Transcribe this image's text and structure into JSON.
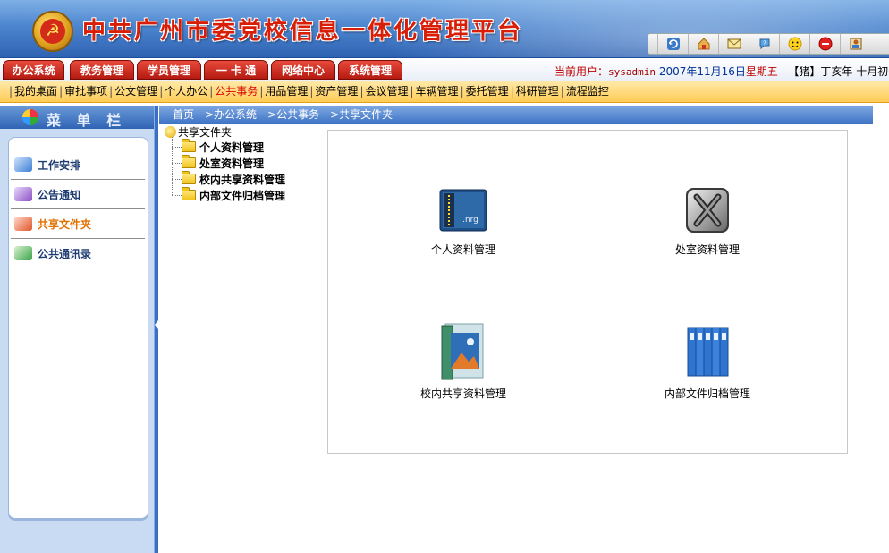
{
  "header": {
    "title": "中共广州市委党校信息一体化管理平台",
    "toolbar_icons": [
      "separator",
      "refresh-icon",
      "home-icon",
      "mail-icon",
      "help-icon",
      "smiley-icon",
      "stop-icon",
      "user-edit-icon"
    ]
  },
  "nav": {
    "tabs": [
      "办公系统",
      "教务管理",
      "学员管理",
      "一 卡 通",
      "网络中心",
      "系统管理"
    ],
    "user_label": "当前用户：",
    "user_name": "sysadmin",
    "date": "2007年11月16日",
    "weekday": "星期五",
    "lunar": "【猪】丁亥年 十月初七"
  },
  "subnav": {
    "items": [
      "我的桌面",
      "审批事项",
      "公文管理",
      "个人办公",
      "公共事务",
      "用品管理",
      "资产管理",
      "会议管理",
      "车辆管理",
      "委托管理",
      "科研管理",
      "流程监控"
    ],
    "active": "公共事务"
  },
  "sidebar": {
    "title": "菜 单 栏",
    "items": [
      {
        "label": "工作安排",
        "icon": "calendar-icon",
        "color": "#3a7fd5"
      },
      {
        "label": "公告通知",
        "icon": "notice-icon",
        "color": "#8a4fc4"
      },
      {
        "label": "共享文件夹",
        "icon": "shared-folder-icon",
        "color": "#e0552a"
      },
      {
        "label": "公共通讯录",
        "icon": "address-book-icon",
        "color": "#3aa24a"
      }
    ],
    "active_index": 2
  },
  "breadcrumb": "首页—>办公系统—>公共事务—>共享文件夹",
  "tree": {
    "root": "共享文件夹",
    "nodes": [
      "个人资料管理",
      "处室资料管理",
      "校内共享资料管理",
      "内部文件归档管理"
    ]
  },
  "cards": [
    {
      "label": "个人资料管理",
      "icon": "personal-docs-icon"
    },
    {
      "label": "处室资料管理",
      "icon": "department-docs-icon"
    },
    {
      "label": "校内共享资料管理",
      "icon": "campus-shared-icon"
    },
    {
      "label": "内部文件归档管理",
      "icon": "archive-binders-icon"
    }
  ],
  "colors": {
    "tab_red": "#c8261a",
    "active_orange": "#e07000",
    "header_blue": "#2e63b3",
    "subnav_yellow": "#ffcc55"
  }
}
